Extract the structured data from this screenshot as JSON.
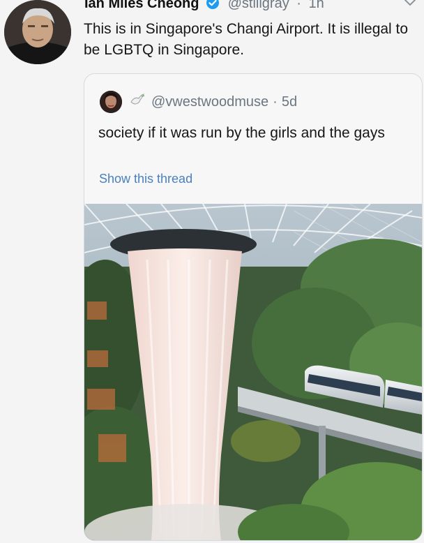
{
  "tweet": {
    "author_name": "Ian Miles Cheong",
    "handle": "@stillgray",
    "time_separator": "·",
    "time": "1h",
    "text": "This is in Singapore's Changi Airport. It is illegal to be LGBTQ in Singapore."
  },
  "quoted_tweet": {
    "handle": "@vwestwoodmuse",
    "time_separator": "·",
    "time": "5d",
    "text": "society if it was run by the girls and the gays",
    "show_thread_label": "Show this thread",
    "image_subject": "Changi Airport Jewel indoor waterfall with sky train"
  },
  "icons": {
    "verified": "verified-badge-icon",
    "more": "chevron-down-icon",
    "emoji": "dove-emoji-icon"
  },
  "colors": {
    "verified_blue": "#1d9bf0",
    "link_blue": "#4a7fbf",
    "muted_gray": "#6b7680"
  }
}
